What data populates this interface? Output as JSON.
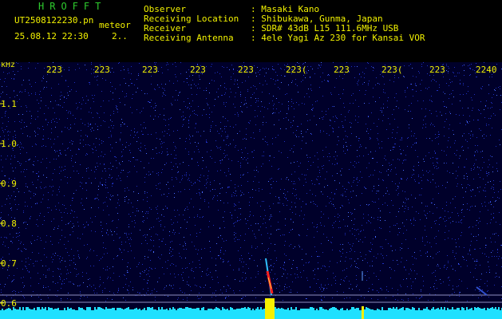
{
  "header": {
    "app_title": "HROFFT",
    "file_name": "UT2508122230.pn",
    "mode": "meteor",
    "datetime": "25.08.12 22:30",
    "counter": "2..",
    "observer_label": "Observer",
    "observer_value": ": Masaki Kano",
    "location_label": "Receiving Location",
    "location_value": ": Shibukawa, Gunma, Japan",
    "receiver_label": "Receiver",
    "receiver_value": ": SDR# 43dB L15 111.6MHz USB",
    "antenna_label": "Receiving Antenna",
    "antenna_value": ": 4ele Yagi Az 230 for Kansai VOR"
  },
  "axis": {
    "y_unit": "kHz",
    "y_ticks": [
      "1.1",
      "1.0",
      "0.9",
      "0.8",
      "0.7",
      "0.6"
    ],
    "x_ticks": [
      "223",
      "223",
      "223",
      "223",
      "223",
      "223(",
      "223",
      "223(",
      "223",
      "2240"
    ]
  },
  "colors": {
    "text_yellow": "#f2f200",
    "title_green": "#2ecc2e",
    "background": "#00002a",
    "noise": "#2030c0",
    "signal_red": "#ff2020",
    "baseline_cyan": "#20e0ff"
  }
}
